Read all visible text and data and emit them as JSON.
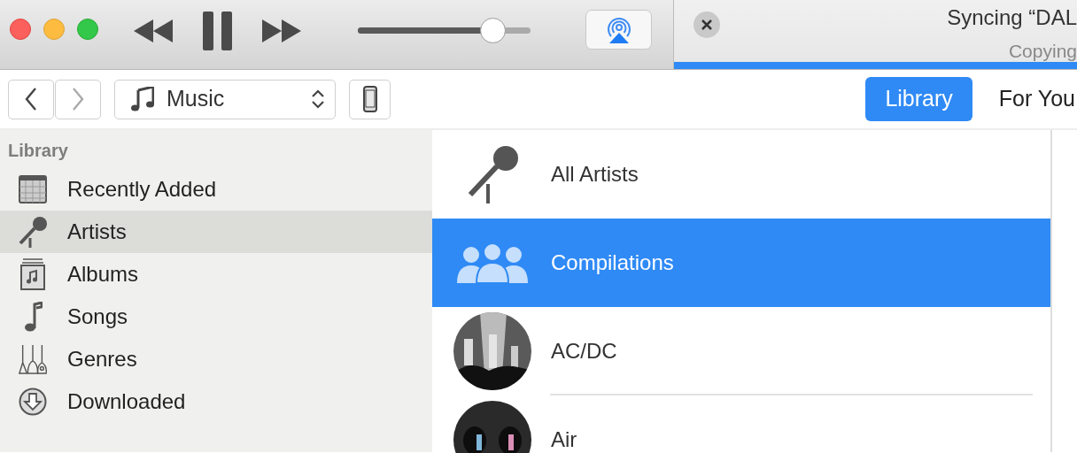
{
  "player": {
    "volume": {
      "level": 0.78
    }
  },
  "sync_status": {
    "title": "Syncing “DAL",
    "subtitle": "Copying",
    "progress": {
      "level": 1
    }
  },
  "navigation": {
    "back": {
      "disabled": false
    },
    "forward": {
      "disabled": true
    }
  },
  "media_picker": {
    "value": "Music"
  },
  "tabs": [
    {
      "label": "Library",
      "selected": true
    },
    {
      "label": "For You",
      "selected": false
    }
  ],
  "sidebar": {
    "heading": "Library",
    "items": [
      {
        "label": "Recently Added",
        "kind": "recent",
        "selected": false
      },
      {
        "label": "Artists",
        "kind": "artists",
        "selected": true
      },
      {
        "label": "Albums",
        "kind": "albums",
        "selected": false
      },
      {
        "label": "Songs",
        "kind": "songs",
        "selected": false
      },
      {
        "label": "Genres",
        "kind": "genres",
        "selected": false
      },
      {
        "label": "Downloaded",
        "kind": "downloaded",
        "selected": false
      }
    ]
  },
  "artists": [
    {
      "name": "All Artists",
      "kind": "all",
      "selected": false
    },
    {
      "name": "Compilations",
      "kind": "compilations",
      "selected": true
    },
    {
      "name": "AC/DC",
      "kind": "picture",
      "selected": false
    },
    {
      "name": "Air",
      "kind": "picture",
      "selected": false
    }
  ]
}
